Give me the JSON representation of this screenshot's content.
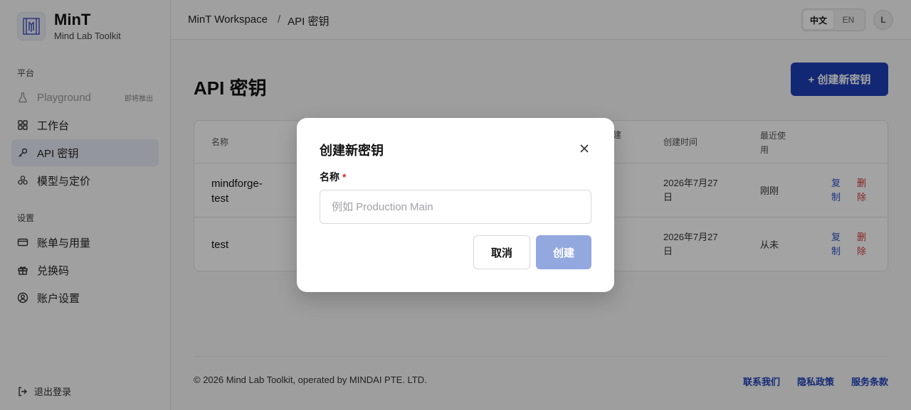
{
  "brand": {
    "title": "MinT",
    "subtitle": "Mind Lab Toolkit"
  },
  "sidebar": {
    "platform_label": "平台",
    "settings_label": "设置",
    "items": [
      {
        "label": "Playground",
        "badge": "即将推出"
      },
      {
        "label": "工作台"
      },
      {
        "label": "API 密钥"
      },
      {
        "label": "模型与定价"
      },
      {
        "label": "账单与用量"
      },
      {
        "label": "兑换码"
      },
      {
        "label": "账户设置"
      }
    ],
    "logout": "退出登录"
  },
  "header": {
    "breadcrumb": [
      "MinT Workspace",
      "API 密钥"
    ],
    "separator": "/",
    "lang": [
      "中文",
      "EN"
    ],
    "avatar": "L"
  },
  "main": {
    "title": "API 密钥",
    "create_button": "+ 创建新密钥",
    "table": {
      "headers": [
        "名称",
        "建",
        "创建时间",
        "最近使用"
      ],
      "rows": [
        {
          "name": "mindforge-test",
          "created": "2026年7月27日",
          "last_used": "刚刚",
          "copy": "复制",
          "delete": "删除"
        },
        {
          "name": "test",
          "created": "2026年7月27日",
          "last_used": "从未",
          "copy": "复制",
          "delete": "删除"
        }
      ]
    }
  },
  "footer": {
    "copyright": "© 2026 Mind Lab Toolkit, operated by MINDAI PTE. LTD.",
    "links": [
      "联系我们",
      "隐私政策",
      "服务条款"
    ]
  },
  "modal": {
    "title": "创建新密钥",
    "field_label": "名称",
    "required_mark": "*",
    "placeholder": "例如 Production Main",
    "value": "",
    "cancel": "取消",
    "create": "创建"
  },
  "colors": {
    "primary": "#1f3fb8",
    "primary_disabled": "#94a8e0",
    "danger": "#d23a3a",
    "link": "#2a52c8"
  }
}
